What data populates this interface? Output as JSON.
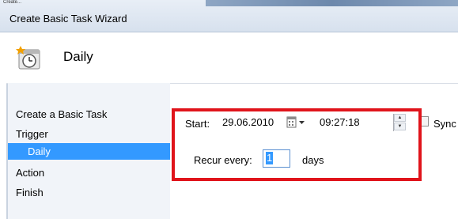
{
  "window": {
    "title": "Create Basic Task Wizard",
    "top_fragment": "Create..."
  },
  "header": {
    "title": "Daily",
    "icon": "clock-calendar-icon"
  },
  "nav": {
    "items": [
      {
        "label": "Create a Basic Task",
        "selected": false
      },
      {
        "label": "Trigger",
        "selected": false
      },
      {
        "label": "Daily",
        "selected": true
      },
      {
        "label": "Action",
        "selected": false
      },
      {
        "label": "Finish",
        "selected": false
      }
    ]
  },
  "form": {
    "start_label": "Start:",
    "start_date": "29.06.2010",
    "start_time": "09:27:18",
    "sync_label": "Sync",
    "recur_label": "Recur every:",
    "recur_value": "1",
    "recur_unit": "days"
  },
  "colors": {
    "highlight_border": "#e0141b",
    "selection": "#3399ff"
  }
}
